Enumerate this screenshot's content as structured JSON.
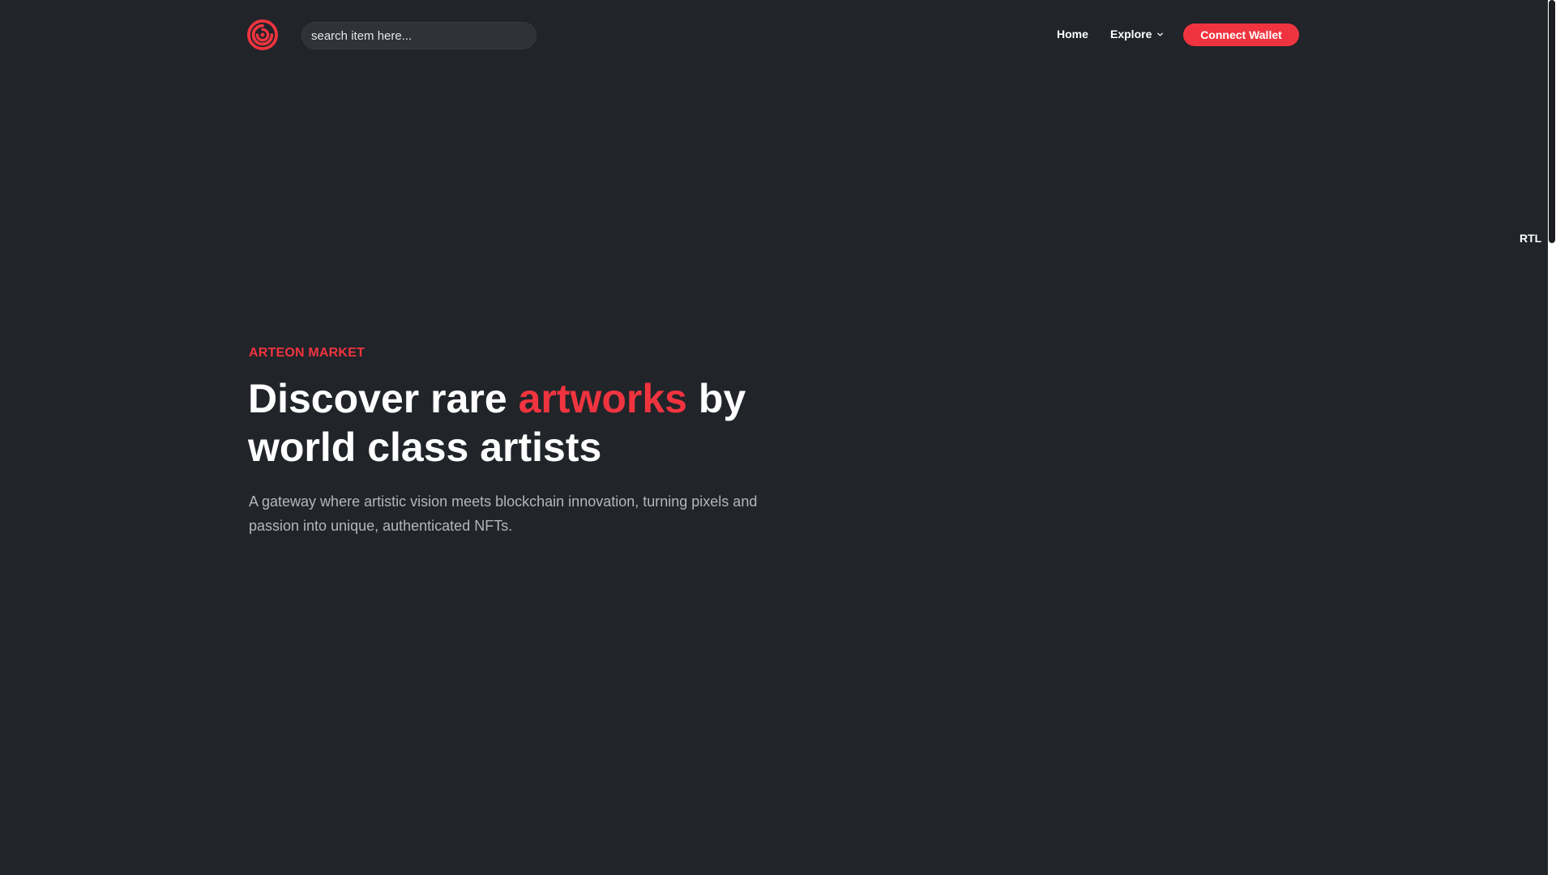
{
  "header": {
    "logo_icon": "spiral-logo-icon",
    "search_placeholder": "search item here...",
    "nav": {
      "home_label": "Home",
      "explore_label": "Explore",
      "explore_icon": "chevron-down-icon"
    },
    "connect_label": "Connect Wallet"
  },
  "side": {
    "rtl_label": "RTL"
  },
  "hero": {
    "eyebrow": "ARTEON MARKET",
    "title_pre": "Discover rare",
    "title_accent": "artworks",
    "title_post": "by world class artists",
    "subtitle": "A gateway where artistic vision meets blockchain innovation, turning pixels and passion into unique, authenticated NFTs."
  },
  "colors": {
    "background": "#212429",
    "accent": "#f0343f",
    "text": "#ffffff",
    "muted": "#b4b6bb"
  }
}
